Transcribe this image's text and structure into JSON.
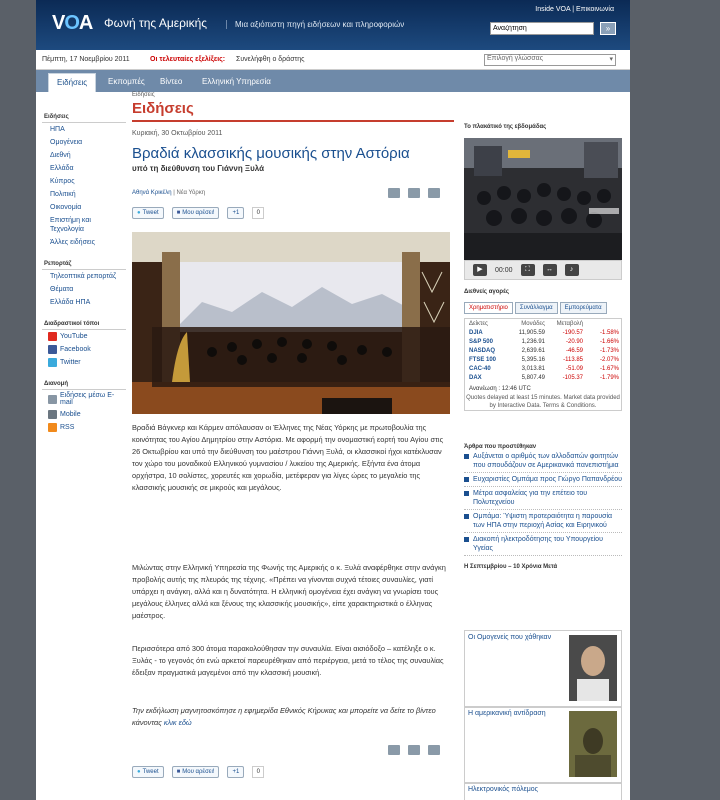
{
  "header": {
    "logo_v": "V",
    "logo_a": "O",
    "logo_rest": "A",
    "site_name": "Φωνή της Αμερικής",
    "tagline": "Μια αξιόπιστη πηγή ειδήσεων και πληροφοριών",
    "inside_voa": "Inside VOA",
    "contact": "Επικοινωνία",
    "search_placeholder": "Αναζήτηση",
    "search_button": "»"
  },
  "datebar": {
    "date": "Πέμπτη, 17 Νοεμβρίου 2011",
    "latest_label": "Οι τελευταίες εξελίξεις:",
    "latest_text": "Συνελήφθη ο δράστης",
    "language_select": "Επιλογή γλώσσας"
  },
  "nav": {
    "tabs": [
      "Ειδήσεις",
      "Εκπομπές",
      "Βίντεο",
      "Ελληνική Υπηρεσία"
    ]
  },
  "breadcrumb": "Ειδήσεις",
  "sidebar": {
    "news_heading": "Ειδήσεις",
    "news_items": [
      "ΗΠΑ",
      "Ομογένεια",
      "Διεθνή",
      "Ελλάδα",
      "Κύπρος",
      "Πολιτική",
      "Οικονομία",
      "Επιστήμη και Τεχνολογία",
      "Άλλες ειδήσεις"
    ],
    "reports_heading": "Ρεπορτάζ",
    "reports_items": [
      "Τηλεοπτικά ρεπορτάζ",
      "Θέματα",
      "Ελλάδα ΗΠΑ"
    ],
    "interactive_heading": "Διαδραστικοί τόποι",
    "interactive_items": [
      "YouTube",
      "Facebook",
      "Twitter"
    ],
    "distribution_heading": "Διανομή",
    "distribution_items": [
      "Ειδήσεις μέσω E-mail",
      "Mobile",
      "RSS"
    ]
  },
  "article": {
    "section_title": "Ειδήσεις",
    "pub_date": "Κυριακή, 30 Οκτωβρίου 2011",
    "title": "Βραδιά κλασσικής μουσικής στην Αστόρια",
    "subtitle": "υπό τη διεύθυνση του Γιάννη Ξυλά",
    "author": "Αθηνά Κρικέλη",
    "location": "Νέα Υόρκη",
    "tweet_label": "Tweet",
    "like_label": "Μου αρέσει!",
    "plus_label": "+1",
    "plus_count": "0",
    "para1": "Βραδιά Βάγκνερ και Κάρμεν απόλαυσαν οι Έλληνες της Νέας Υόρκης με πρωτοβουλία της κοινότητας του Αγίου Δημητρίου στην Αστόρια.  Με αφορμή την ονομαστική εορτή του Αγίου στις 26 Οκτωβρίου και υπό την διεύθυνση του μαέστρου Γιάννη Ξυλά, οι κλασσικοί ήχοι κατέκλυσαν τον χώρο του μοναδικού Ελληνικού γυμνασίου / λυκείου της Αμερικής.  Εξήντα ένα άτομα ορχήστρα, 10 σολίστες, χορευτές και χορωδία, μετέφεραν για λίγες ώρες το μεγαλείο της κλασσικής μουσικής σε μικρούς και μεγάλους.",
    "para2": "Μιλώντας στην Ελληνική Υπηρεσία της Φωνής της Αμερικής ο κ. Ξυλά αναφέρθηκε στην ανάγκη προβολής αυτής της πλευράς της τέχνης.  «Πρέπει να γίνονται συχνά τέτοιες συναυλίες, γιατί υπάρχει η ανάγκη, αλλά και η δυνατότητα.  Η ελληνική ομογένεια έχει ανάγκη να γνωρίσει τους μεγάλους έλληνες αλλά και ξένους της κλασσικής μουσικής», είπε χαρακτηριστικά ο έλληνας μαέστρος.",
    "para3": "Περισσότερα από 300 άτομα παρακολούθησαν την συναυλία.  Είναι αισιόδοξο – κατέληξε ο κ. Ξυλάς - το γεγονός ότι ενώ αρκετοί παρευρέθηκαν από περιέργεια, μετά το τέλος της συναυλίας έδειξαν πραγματικά μαγεμένοι από την κλασσική μουσική.",
    "para4": "Την εκδήλωση μαγνητοσκόπησε η εφημερίδα Εθνικός Κήρυκας και μπορείτε να δείτε το βίντεο κάνοντας",
    "para4_link": "κλικ εδώ"
  },
  "right": {
    "video_heading": "Το πλακάτικό της εβδομάδας",
    "video_time": "00:00",
    "markets_heading": "Διεθνείς αγορές",
    "market_tabs": [
      "Χρηματιστήριο",
      "Συνάλλαγμα",
      "Εμπορεύματα"
    ],
    "market_header": [
      "Δείκτες",
      "Μονάδες",
      "Μεταβολή",
      ""
    ],
    "market_rows": [
      [
        "DJIA",
        "11,905.59",
        "-190.57",
        "-1.58%"
      ],
      [
        "S&P 500",
        "1,236.91",
        "-20.90",
        "-1.66%"
      ],
      [
        "NASDAQ",
        "2,639.61",
        "-46.59",
        "-1.73%"
      ],
      [
        "FTSE 100",
        "5,395.16",
        "-113.85",
        "-2.07%"
      ],
      [
        "CAC-40",
        "3,013.81",
        "-51.09",
        "-1.67%"
      ],
      [
        "DAX",
        "5,807.49",
        "-105.37",
        "-1.79%"
      ]
    ],
    "market_updated": "Ανανέωση :  12:46 UTC",
    "market_note": "Quotes delayed at least 15 minutes. Market data provided by Interactive Data. Terms & Conditions.",
    "popular_heading": "Άρθρα που προστέθηκαν",
    "popular_items": [
      "Αυξάνεται ο αριθμός των αλλοδαπών φοιτητών που σπουδάζουν σε Αμερικανικά πανεπιστήμια",
      "Ευχαριστίες Ομπάμα προς Γιώργο Παπανδρέου",
      "Μέτρα ασφαλείας για την επέτειο του Πολυτεχνείου",
      "Ομπάμα: Ύψιστη προτεραιότητα η παρουσία των ΗΠΑ στην περιοχή Ασίας και Ειρηνικού",
      "Διακοπή ηλεκτροδότησης του Υπουργείου Υγείας"
    ],
    "series_heading": "Η Σεπτεμβρίου – 10 Χρόνια Μετά",
    "series_items": [
      "Οι Ομογενείς που χάθηκαν",
      "Η αμερικανική αντίδραση",
      "Ηλεκτρονικός πόλεμος"
    ]
  }
}
